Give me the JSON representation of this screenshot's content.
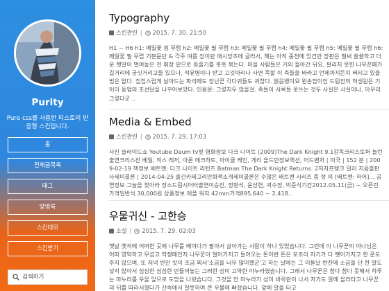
{
  "sidebar": {
    "blog_title": "Purity",
    "description": "Pure css를 사용한 티스토리 반응형 스킨입니다.",
    "nav": [
      {
        "label": "홈"
      },
      {
        "label": "전체글목록"
      },
      {
        "label": "태그"
      },
      {
        "label": "방명록"
      },
      {
        "label": "스킨데모"
      },
      {
        "label": "스킨받기"
      }
    ],
    "search_placeholder": "검색하기"
  },
  "posts": [
    {
      "title": "Typography",
      "category": "스킨관련",
      "datetime": "2015. 7. 30. 21:50",
      "excerpt": "H1 ~ H6 h1: 메일꽃 핑 무렵 h2: 메일꽃 필 무렵 h3: 메일꽃 필 무렵 h4: 메일꽃 필 무렵 h5: 메일꽃 필 무렵 h6: 메일꽃 필 무렵 기본문단 & 각주 여름 장이란 애시당초에 글러서, 해는 아직 중천에 있건만 장판은 벌써 쓸쓸하고 더운 햇발이 벌여놓은 전 휘장 밑으로 등줄기를 훅훅 볶는다. 마을 사람들은 거의 돌아간 뒤요, 팔리지 못한 나무꾼패가 길거리에 궁싯거리고들 있으나, 석유병이나 받고 고깃마리나 사면 족할 이 축들을 바라고 언제까지든지 버티고 있을 법은 없다. 칩칩스럽게 날아드는 파리떼도 장난꾼 각다귀들도 귀찮다. 얽음뱅이요 왼손잡이인 드팀전의 허생원은 기어이 동업의 조선달을 나꾸어보았다. 인용문: 그렇지두 않을걸. 죽들이 사록들 못쓰는 것두 사실은 사실이나, 아무리 그렇다군 .."
    },
    {
      "title": "Media & Embed",
      "category": "스킨관련",
      "datetime": "2015. 7. 29. 17:03",
      "excerpt": "사진 슬라이드쇼 Youtube Daum tv팟 영화정보 다크 나이트 (2009)The Dark Knight 9.1감독크리스토퍼 놀런출연크리스찬 베일, 히스 레저, 아론 에크하트, 마이클 케인, 게리 올드만정보액션, 어드벤처 | 미국 | 152 분 | 2009-02-19 책정보 배트맨: 다크 나이트 리턴즈 Batman The Dark Knight Returns. 2저자프랭크 밀러 지음출판사세미콜론 | 2014-04-25 출간카테고리만화책소개세미콜론은 수많은 배트맨 시리즈 중 정 의 [배트맨: 하어]... 공연정보 그늘을 찾아라 장소드림시어터출연이승진, 정형석, 윤상현, 곽수정, 박준식기간2012.05.11(금) ~ 오픈런가격일반석 30,000원 상품정보 애플 워치 42mm가격895,640 ~ 2,418.."
    },
    {
      "title": "우물귀신 - 고한승",
      "category": "소설",
      "datetime": "2015. 7. 29. 02:03",
      "excerpt": "옛날 옛적에 어떠한 곳에 나무를 베어다가 팔아서 살아가는 사람이 하나 있었습니다. 그런데 이 나무꾼의 마나님은 어떠 영악하고 무섭고 딱쟁떼인지 나무꾼이 벌어가지고 들어오는 돈이란 돈은 모조리 자기가 다 뺏어가지고 한 푼도 주지 않으며, 또 저녁 반찬 맛이 조금 짜서'소금을 너무 많이했군'고 하는 날에는 그 이튿날 반찬에 소금을 단 한 알도 넣지 않아서 심심한 심심한 만들어놓는 그러한 성미 고약한 마누라였습니다. 그래서 나무꾼은 참다 참다 못해서 하루는 마누라를 우물 앞으로 도망을 나왔습니다. 그것을 안 마누라가 성이 바락같이 나서 자기도 말에 올라타고 나무꾼의 뒤를 따라서쳤다가 산속에서 잘못하여 큰 우물에 빠졌습니다. 앞에 말을 타고"
    }
  ]
}
